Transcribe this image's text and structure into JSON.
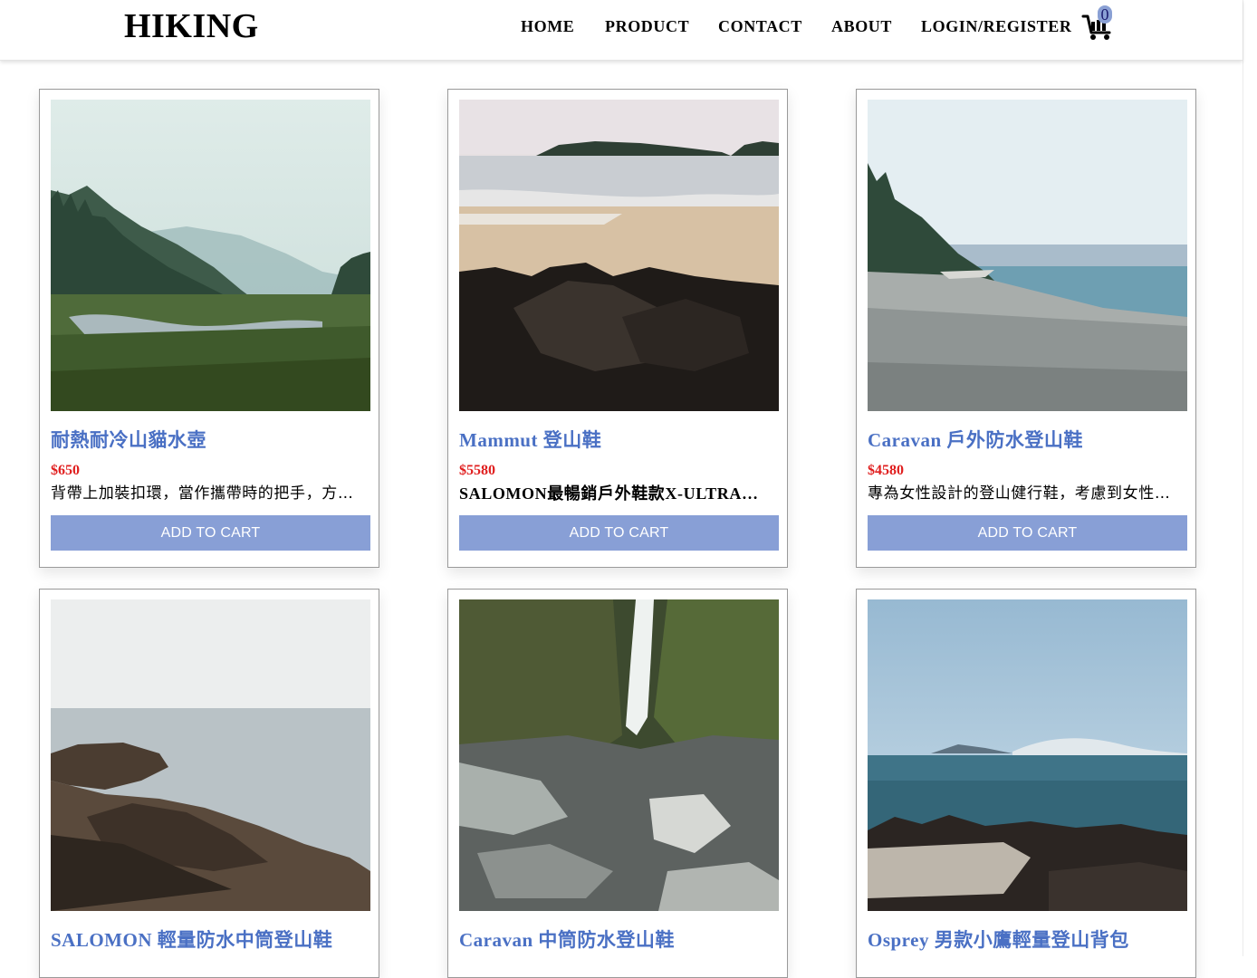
{
  "header": {
    "logo": "HIKING",
    "nav": [
      "HOME",
      "PRODUCT",
      "CONTACT",
      "ABOUT",
      "LOGIN/REGISTER"
    ],
    "cart_icon": "cart-icon",
    "cart_count": "0"
  },
  "colors": {
    "accent": "#889fd6",
    "title": "#4a70c4",
    "price": "#e01e1e"
  },
  "products": [
    {
      "title": "耐熱耐冷山貓水壺",
      "price": "$650",
      "description": "背帶上加裝扣環，當作攜帶時的把手，方便攜帶",
      "button": "ADD TO CART",
      "image": "misty-valley-river"
    },
    {
      "title": "Mammut 登山鞋",
      "price": "$5580",
      "description": "SALOMON最暢銷戶外鞋款X-ULTRA，輕量穩定",
      "button": "ADD TO CART",
      "image": "beach-rocks-island"
    },
    {
      "title": "Caravan 戶外防水登山鞋",
      "price": "$4580",
      "description": "專為女性設計的登山健行鞋，考慮到女性腳型",
      "button": "ADD TO CART",
      "image": "pebble-beach-coast"
    },
    {
      "title": "SALOMON 輕量防水中筒登山鞋",
      "price": "",
      "description": "",
      "button": "",
      "image": "rocky-shore-sea"
    },
    {
      "title": "Caravan 中筒防水登山鞋",
      "price": "",
      "description": "",
      "button": "",
      "image": "forest-waterfall"
    },
    {
      "title": "Osprey 男款小鷹輕量登山背包",
      "price": "",
      "description": "",
      "button": "",
      "image": "ocean-rocks-driftwood"
    }
  ]
}
